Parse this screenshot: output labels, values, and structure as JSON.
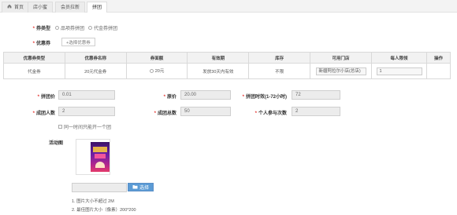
{
  "tabs": [
    {
      "label": "首页",
      "icon": "home-icon"
    },
    {
      "label": "店小蜜"
    },
    {
      "label": "会员拉新"
    },
    {
      "label": "拼团",
      "active": true
    }
  ],
  "form": {
    "coupon_type_label": "券类型",
    "coupon_type_options": [
      "品项券拼团",
      "代金券拼团"
    ],
    "coupon_label": "优惠券",
    "select_coupon_button": "+选择优惠券"
  },
  "table": {
    "headers": [
      "优惠券类型",
      "优惠券名称",
      "券面额",
      "有效期",
      "库存",
      "可用门店",
      "每人限领",
      "操作"
    ],
    "rows": [
      {
        "type": "代金券",
        "name": "20元代金券",
        "amount": "20元",
        "validity": "发放30天内有效",
        "stock": "不限",
        "store": "新疆阿拉尔小店(总店)",
        "limit": "1",
        "action": ""
      }
    ]
  },
  "fields": {
    "group_price_label": "拼团价",
    "group_price": "0.01",
    "original_price_label": "原价",
    "original_price": "20.00",
    "group_time_label": "拼团时效(1-72小时)",
    "group_time": "72",
    "group_size_label": "成团人数",
    "group_size": "2",
    "total_groups_label": "成团总数",
    "total_groups": "50",
    "per_person_label": "个人参与次数",
    "per_person": "2",
    "same_time_checkbox": "同一时间只能开一个团",
    "activity_image_label": "活动图",
    "upload_button": "选择"
  },
  "notes": [
    "1. 图片大小不超过 2M",
    "2. 最佳图片大小（像素）200*200"
  ]
}
